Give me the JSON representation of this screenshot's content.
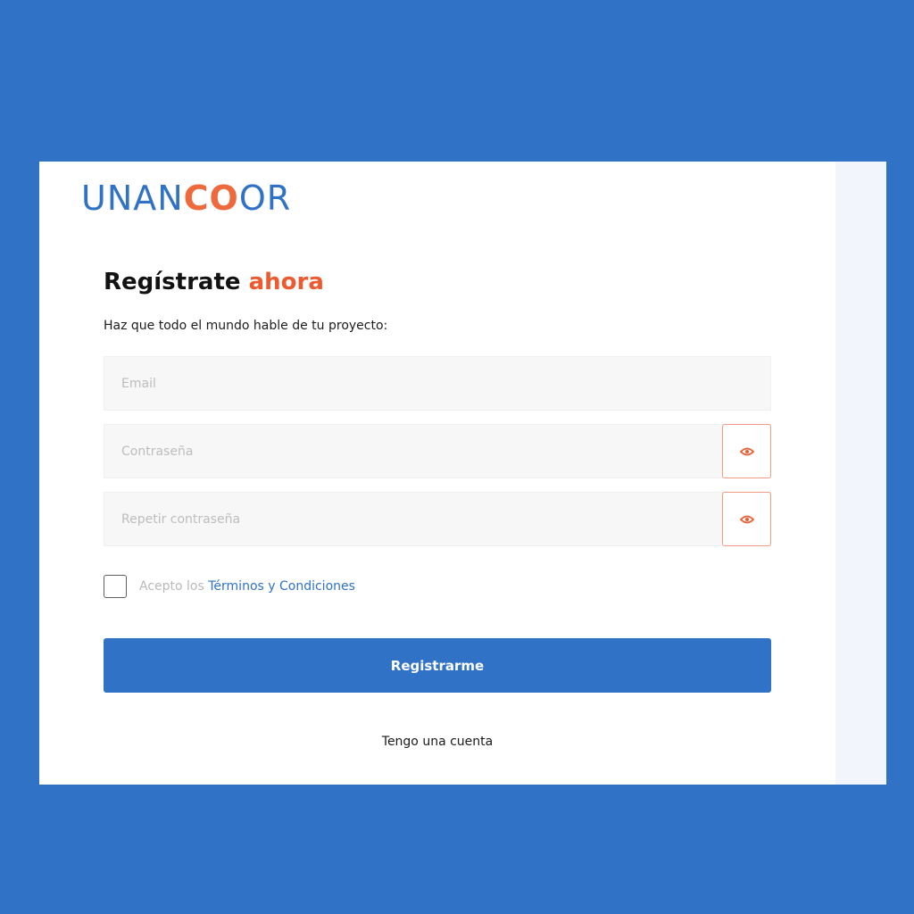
{
  "brand": {
    "logo_a": "UNAN",
    "logo_b": "CO",
    "logo_c": "OR",
    "primary_color": "#2f72c6",
    "accent_color": "#ee5a2f"
  },
  "form": {
    "title_main": "Regístrate",
    "title_accent": "ahora",
    "subtitle": "Haz que todo el mundo hable de tu proyecto:",
    "email_placeholder": "Email",
    "password_placeholder": "Contraseña",
    "repeat_password_placeholder": "Repetir contraseña",
    "password_toggle_icon": "eye-icon",
    "terms_prefix": "Acepto los",
    "terms_link": "Términos y Condiciones",
    "submit_label": "Registrarme",
    "login_link": "Tengo una cuenta"
  }
}
